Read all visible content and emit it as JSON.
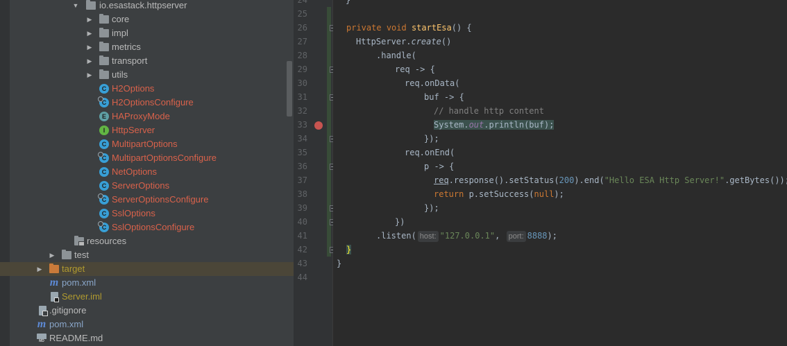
{
  "tree": {
    "rows": [
      {
        "label": "io.esastack.httpserver",
        "color": "normal",
        "icon": "folder-icon"
      },
      {
        "label": "core",
        "color": "normal",
        "icon": "folder-icon"
      },
      {
        "label": "impl",
        "color": "normal",
        "icon": "folder-icon"
      },
      {
        "label": "metrics",
        "color": "normal",
        "icon": "folder-icon"
      },
      {
        "label": "transport",
        "color": "normal",
        "icon": "folder-icon"
      },
      {
        "label": "utils",
        "color": "normal",
        "icon": "folder-icon"
      },
      {
        "label": "H2Options",
        "color": "red",
        "icon": "class-icon"
      },
      {
        "label": "H2OptionsConfigure",
        "color": "red",
        "icon": "class-icon"
      },
      {
        "label": "HAProxyMode",
        "color": "red",
        "icon": "enum-icon"
      },
      {
        "label": "HttpServer",
        "color": "red",
        "icon": "interface-icon"
      },
      {
        "label": "MultipartOptions",
        "color": "red",
        "icon": "class-icon"
      },
      {
        "label": "MultipartOptionsConfigure",
        "color": "red",
        "icon": "class-icon"
      },
      {
        "label": "NetOptions",
        "color": "red",
        "icon": "class-icon"
      },
      {
        "label": "ServerOptions",
        "color": "red",
        "icon": "class-icon"
      },
      {
        "label": "ServerOptionsConfigure",
        "color": "red",
        "icon": "class-icon"
      },
      {
        "label": "SslOptions",
        "color": "red",
        "icon": "class-icon"
      },
      {
        "label": "SslOptionsConfigure",
        "color": "red",
        "icon": "class-icon"
      },
      {
        "label": "resources",
        "color": "normal",
        "icon": "resources-folder-icon"
      },
      {
        "label": "test",
        "color": "normal",
        "icon": "folder-icon"
      },
      {
        "label": "target",
        "color": "yellow",
        "icon": "excluded-folder-icon"
      },
      {
        "label": "pom.xml",
        "color": "blue",
        "icon": "maven-icon"
      },
      {
        "label": "Server.iml",
        "color": "yellow",
        "icon": "iml-file-icon"
      },
      {
        "label": ".gitignore",
        "color": "normal",
        "icon": "gitignore-file-icon"
      },
      {
        "label": "pom.xml",
        "color": "blue",
        "icon": "maven-icon"
      },
      {
        "label": "README.md",
        "color": "normal",
        "icon": "markdown-file-icon"
      }
    ],
    "class_letters": {
      "class": "C",
      "enum": "E",
      "interface": "I"
    }
  },
  "editor": {
    "line_numbers": [
      "24",
      "25",
      "26",
      "27",
      "28",
      "29",
      "30",
      "31",
      "32",
      "33",
      "34",
      "35",
      "36",
      "37",
      "38",
      "39",
      "40",
      "41",
      "42",
      "43",
      "44"
    ],
    "line24_tail": "}",
    "code": {
      "l26": {
        "kw1": "private",
        "kw2": "void",
        "name": "startEsa",
        "rest": "() {"
      },
      "l27": {
        "cls": "HttpServer.",
        "call": "create",
        "rest": "()"
      },
      "l28": ".handle(",
      "l29": "req -> {",
      "l30": "req.onData(",
      "l31": "buf -> {",
      "l32": "// handle http content",
      "l33": {
        "a": "System.",
        "field": "out",
        "b": ".println(buf);"
      },
      "l34": "});",
      "l35": "req.onEnd(",
      "l36": "p -> {",
      "l37": {
        "req": "req",
        "a": ".response().setStatus(",
        "num": "200",
        "b": ").end(",
        "str": "\"Hello ESA Http Server!\"",
        "c": ".getBytes());"
      },
      "l38": {
        "kw": "return",
        "a": " p.setSuccess(",
        "kw2": "null",
        "b": ");"
      },
      "l39": "});",
      "l40": "})",
      "l41": {
        "a": ".listen(",
        "hint1": "host:",
        "str": "\"127.0.0.1\"",
        "comma": ",",
        "hint2": "port:",
        "num": "8888",
        "b": ");"
      },
      "l42": "}",
      "l43": "}"
    }
  },
  "colors": {
    "tree_bg": "#3c3f41",
    "editor_bg": "#2b2b2b",
    "keyword": "#cc7832",
    "method": "#ffc66d",
    "string": "#6a8759",
    "number": "#6897bb",
    "comment": "#808080",
    "field": "#9876aa",
    "breakpoint": "#c75450",
    "red_file": "#d9624b",
    "yellow_file": "#b09a2f"
  }
}
